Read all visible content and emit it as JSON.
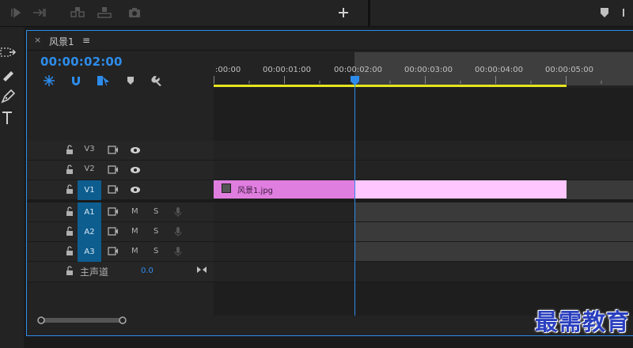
{
  "sequence": {
    "tab_title": "风景1",
    "timecode": "00:00:02:00"
  },
  "ruler": {
    "ticks": [
      ":00:00",
      "00:00:01:00",
      "00:00:02:00",
      "00:00:03:00",
      "00:00:04:00",
      "00:00:05:00"
    ]
  },
  "tracks": {
    "video": [
      {
        "label": "V3",
        "source": ""
      },
      {
        "label": "V2",
        "source": ""
      },
      {
        "label": "V1",
        "source": "V1"
      }
    ],
    "audio": [
      {
        "label": "A1",
        "source": "A1",
        "mute": "M",
        "solo": "S"
      },
      {
        "label": "A2",
        "source": "A2",
        "mute": "M",
        "solo": "S"
      },
      {
        "label": "A3",
        "source": "A3",
        "mute": "M",
        "solo": "S"
      }
    ],
    "master": {
      "label": "主声道",
      "value": "0.0"
    }
  },
  "clip": {
    "name": "风景1.jpg"
  },
  "watermark": "最需教育",
  "colors": {
    "accent": "#2d8ceb",
    "clip_selected": "#e07ee0",
    "clip": "#ffc6ff",
    "work_area": "#e5e520"
  },
  "icons": [
    "insert-icon",
    "overwrite-icon",
    "lift-icon",
    "extract-icon",
    "camera-icon",
    "plus-icon",
    "marker-icon",
    "lock-icon",
    "film-icon",
    "eye-icon",
    "mic-icon",
    "wrench-icon",
    "snap-icon",
    "magnet-icon",
    "linked-selection-icon",
    "pen-icon",
    "type-icon",
    "razor-icon",
    "track-select-icon"
  ]
}
